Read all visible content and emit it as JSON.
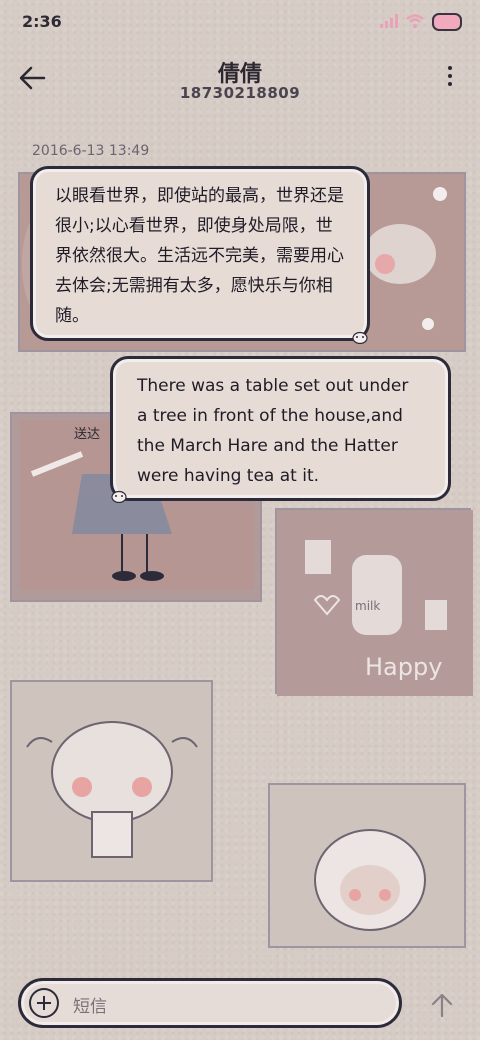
{
  "status_bar": {
    "time": "2:36"
  },
  "header": {
    "title": "倩倩",
    "phone": "18730218809"
  },
  "conversation": {
    "timestamp": "2016-6-13 13:49",
    "messages": [
      {
        "direction": "incoming",
        "text": "以眼看世界，即使站的最高，世界还是很小;以心看世界，即使身处局限，世界依然很大。生活远不完美，需要用心去体会;无需拥有太多，愿快乐与你相随。"
      },
      {
        "direction": "outgoing",
        "text": "There was a table set out under a tree in front of the house,and the March Hare and the Hatter were having tea at it.",
        "status": "送达"
      }
    ]
  },
  "background_doodles": {
    "happy_text": "Happy",
    "milk_text": "milk"
  },
  "input": {
    "placeholder": "短信"
  },
  "icons": [
    "back-arrow-icon",
    "more-vert-icon",
    "plus-icon",
    "send-arrow-icon",
    "signal-icon",
    "wifi-icon",
    "battery-icon",
    "cow-badge-icon"
  ],
  "colors": {
    "background": "#d6ccc5",
    "bubble": "#e7dbd6",
    "outline": "#2d2b3a",
    "battery": "#f0a9bd"
  }
}
